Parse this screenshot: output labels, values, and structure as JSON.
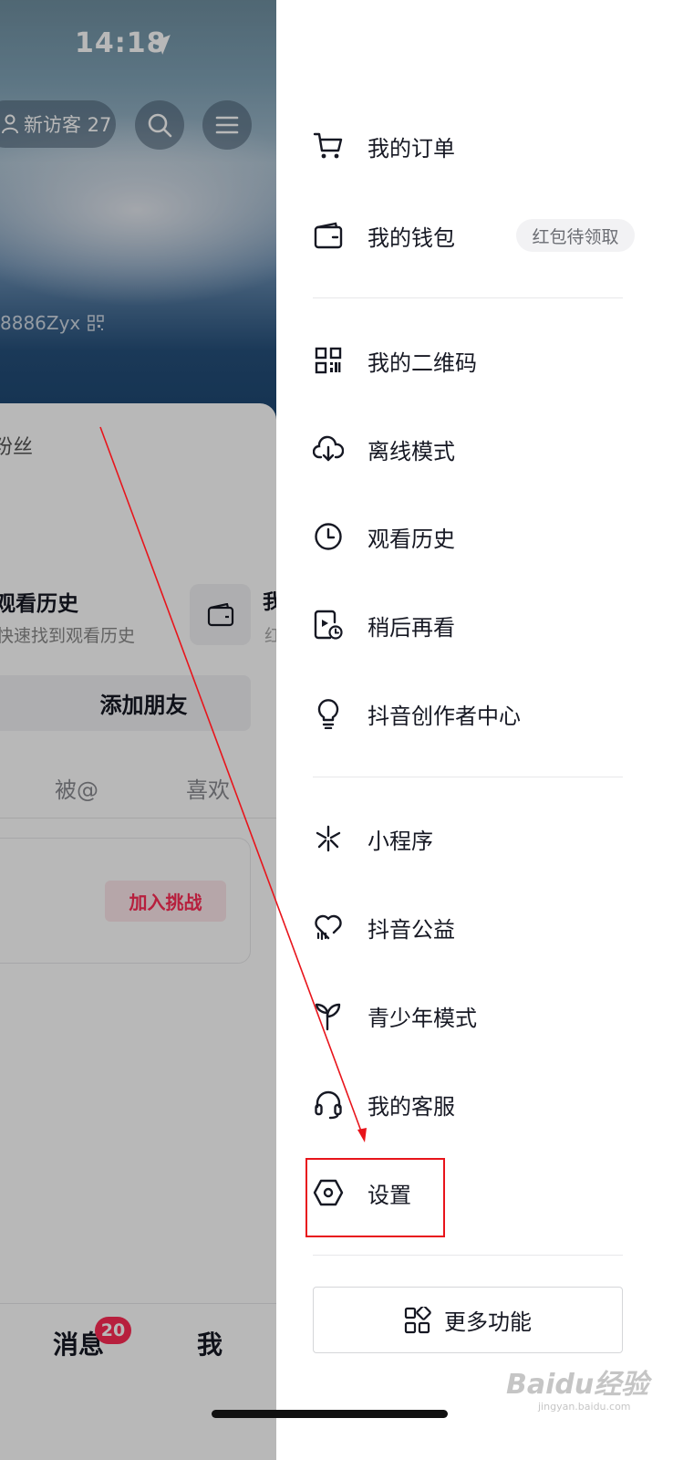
{
  "status_bar": {
    "time": "14:18"
  },
  "profile": {
    "visitor_label": "新访客 27",
    "douyin_id": "8886Zyx",
    "fans_label": "粉丝",
    "history_title": "观看历史",
    "history_sub": "快速找到观看历史",
    "wallet_tile_title": "我",
    "wallet_tile_sub": "红",
    "add_friend": "添加朋友",
    "tabs": [
      "被@",
      "喜欢"
    ],
    "join_challenge": "加入挑战"
  },
  "bottom_nav": {
    "messages": "消息",
    "messages_badge": "20",
    "me": "我"
  },
  "drawer": {
    "items": [
      {
        "label": "我的订单",
        "icon": "cart-icon"
      },
      {
        "label": "我的钱包",
        "icon": "wallet-icon",
        "tag": "红包待领取"
      },
      {
        "label": "我的二维码",
        "icon": "qrcode-icon"
      },
      {
        "label": "离线模式",
        "icon": "cloud-download-icon"
      },
      {
        "label": "观看历史",
        "icon": "clock-icon"
      },
      {
        "label": "稍后再看",
        "icon": "watch-later-icon"
      },
      {
        "label": "抖音创作者中心",
        "icon": "lightbulb-icon"
      },
      {
        "label": "小程序",
        "icon": "mini-program-icon"
      },
      {
        "label": "抖音公益",
        "icon": "charity-heart-icon"
      },
      {
        "label": "青少年模式",
        "icon": "sprout-icon"
      },
      {
        "label": "我的客服",
        "icon": "headset-icon"
      },
      {
        "label": "设置",
        "icon": "settings-hexagon-icon"
      }
    ],
    "more_button": "更多功能"
  },
  "watermark": {
    "text": "Baidu经验",
    "sub": "jingyan.baidu.com"
  },
  "colors": {
    "accent": "#fe2c55",
    "annotation": "#e8141b"
  }
}
